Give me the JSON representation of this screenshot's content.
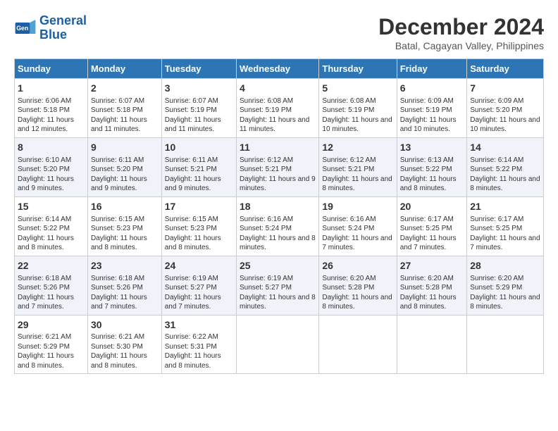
{
  "logo": {
    "line1": "General",
    "line2": "Blue"
  },
  "title": "December 2024",
  "subtitle": "Batal, Cagayan Valley, Philippines",
  "headers": [
    "Sunday",
    "Monday",
    "Tuesday",
    "Wednesday",
    "Thursday",
    "Friday",
    "Saturday"
  ],
  "weeks": [
    [
      {
        "day": "1",
        "sunrise": "6:06 AM",
        "sunset": "5:18 PM",
        "daylight": "11 hours and 12 minutes."
      },
      {
        "day": "2",
        "sunrise": "6:07 AM",
        "sunset": "5:18 PM",
        "daylight": "11 hours and 11 minutes."
      },
      {
        "day": "3",
        "sunrise": "6:07 AM",
        "sunset": "5:19 PM",
        "daylight": "11 hours and 11 minutes."
      },
      {
        "day": "4",
        "sunrise": "6:08 AM",
        "sunset": "5:19 PM",
        "daylight": "11 hours and 11 minutes."
      },
      {
        "day": "5",
        "sunrise": "6:08 AM",
        "sunset": "5:19 PM",
        "daylight": "11 hours and 10 minutes."
      },
      {
        "day": "6",
        "sunrise": "6:09 AM",
        "sunset": "5:19 PM",
        "daylight": "11 hours and 10 minutes."
      },
      {
        "day": "7",
        "sunrise": "6:09 AM",
        "sunset": "5:20 PM",
        "daylight": "11 hours and 10 minutes."
      }
    ],
    [
      {
        "day": "8",
        "sunrise": "6:10 AM",
        "sunset": "5:20 PM",
        "daylight": "11 hours and 9 minutes."
      },
      {
        "day": "9",
        "sunrise": "6:11 AM",
        "sunset": "5:20 PM",
        "daylight": "11 hours and 9 minutes."
      },
      {
        "day": "10",
        "sunrise": "6:11 AM",
        "sunset": "5:21 PM",
        "daylight": "11 hours and 9 minutes."
      },
      {
        "day": "11",
        "sunrise": "6:12 AM",
        "sunset": "5:21 PM",
        "daylight": "11 hours and 9 minutes."
      },
      {
        "day": "12",
        "sunrise": "6:12 AM",
        "sunset": "5:21 PM",
        "daylight": "11 hours and 8 minutes."
      },
      {
        "day": "13",
        "sunrise": "6:13 AM",
        "sunset": "5:22 PM",
        "daylight": "11 hours and 8 minutes."
      },
      {
        "day": "14",
        "sunrise": "6:14 AM",
        "sunset": "5:22 PM",
        "daylight": "11 hours and 8 minutes."
      }
    ],
    [
      {
        "day": "15",
        "sunrise": "6:14 AM",
        "sunset": "5:22 PM",
        "daylight": "11 hours and 8 minutes."
      },
      {
        "day": "16",
        "sunrise": "6:15 AM",
        "sunset": "5:23 PM",
        "daylight": "11 hours and 8 minutes."
      },
      {
        "day": "17",
        "sunrise": "6:15 AM",
        "sunset": "5:23 PM",
        "daylight": "11 hours and 8 minutes."
      },
      {
        "day": "18",
        "sunrise": "6:16 AM",
        "sunset": "5:24 PM",
        "daylight": "11 hours and 8 minutes."
      },
      {
        "day": "19",
        "sunrise": "6:16 AM",
        "sunset": "5:24 PM",
        "daylight": "11 hours and 7 minutes."
      },
      {
        "day": "20",
        "sunrise": "6:17 AM",
        "sunset": "5:25 PM",
        "daylight": "11 hours and 7 minutes."
      },
      {
        "day": "21",
        "sunrise": "6:17 AM",
        "sunset": "5:25 PM",
        "daylight": "11 hours and 7 minutes."
      }
    ],
    [
      {
        "day": "22",
        "sunrise": "6:18 AM",
        "sunset": "5:26 PM",
        "daylight": "11 hours and 7 minutes."
      },
      {
        "day": "23",
        "sunrise": "6:18 AM",
        "sunset": "5:26 PM",
        "daylight": "11 hours and 7 minutes."
      },
      {
        "day": "24",
        "sunrise": "6:19 AM",
        "sunset": "5:27 PM",
        "daylight": "11 hours and 7 minutes."
      },
      {
        "day": "25",
        "sunrise": "6:19 AM",
        "sunset": "5:27 PM",
        "daylight": "11 hours and 8 minutes."
      },
      {
        "day": "26",
        "sunrise": "6:20 AM",
        "sunset": "5:28 PM",
        "daylight": "11 hours and 8 minutes."
      },
      {
        "day": "27",
        "sunrise": "6:20 AM",
        "sunset": "5:28 PM",
        "daylight": "11 hours and 8 minutes."
      },
      {
        "day": "28",
        "sunrise": "6:20 AM",
        "sunset": "5:29 PM",
        "daylight": "11 hours and 8 minutes."
      }
    ],
    [
      {
        "day": "29",
        "sunrise": "6:21 AM",
        "sunset": "5:29 PM",
        "daylight": "11 hours and 8 minutes."
      },
      {
        "day": "30",
        "sunrise": "6:21 AM",
        "sunset": "5:30 PM",
        "daylight": "11 hours and 8 minutes."
      },
      {
        "day": "31",
        "sunrise": "6:22 AM",
        "sunset": "5:31 PM",
        "daylight": "11 hours and 8 minutes."
      },
      null,
      null,
      null,
      null
    ]
  ],
  "labels": {
    "sunrise": "Sunrise:",
    "sunset": "Sunset:",
    "daylight": "Daylight:"
  }
}
